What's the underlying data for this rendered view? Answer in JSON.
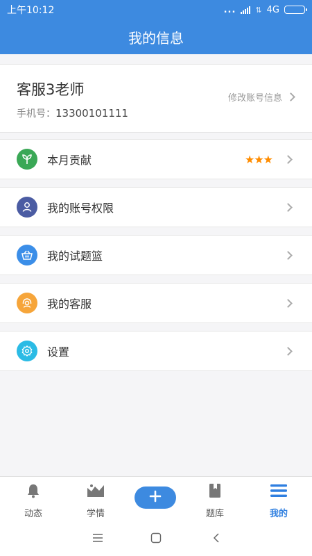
{
  "status_bar": {
    "time": "上午10:12",
    "network": "4G",
    "dots": "...",
    "data_arrows": "⇅"
  },
  "header": {
    "title": "我的信息"
  },
  "profile": {
    "name": "客服3老师",
    "phone_label": "手机号：",
    "phone": "13300101111",
    "edit_label": "修改账号信息"
  },
  "menu": {
    "items": [
      {
        "label": "本月贡献",
        "icon": "sprout-icon",
        "color": "#3aa856",
        "stars": "★★★",
        "rating": 3
      },
      {
        "label": "我的账号权限",
        "icon": "user-icon",
        "color": "#4b5ca3"
      },
      {
        "label": "我的试题篮",
        "icon": "basket-icon",
        "color": "#3b8ee8"
      },
      {
        "label": "我的客服",
        "icon": "headset-icon",
        "color": "#f6a53a"
      },
      {
        "label": "设置",
        "icon": "gear-icon",
        "color": "#2bbbe5"
      }
    ]
  },
  "bottom_nav": {
    "items": [
      {
        "label": "动态",
        "icon": "bell-icon"
      },
      {
        "label": "学情",
        "icon": "chart-icon"
      },
      {
        "label": "",
        "icon": "plus-icon"
      },
      {
        "label": "题库",
        "icon": "book-icon"
      },
      {
        "label": "我的",
        "icon": "menu-icon",
        "active": true
      }
    ]
  },
  "colors": {
    "primary": "#3d8ae0",
    "active": "#2f7fe0",
    "star": "#ff8c00"
  }
}
